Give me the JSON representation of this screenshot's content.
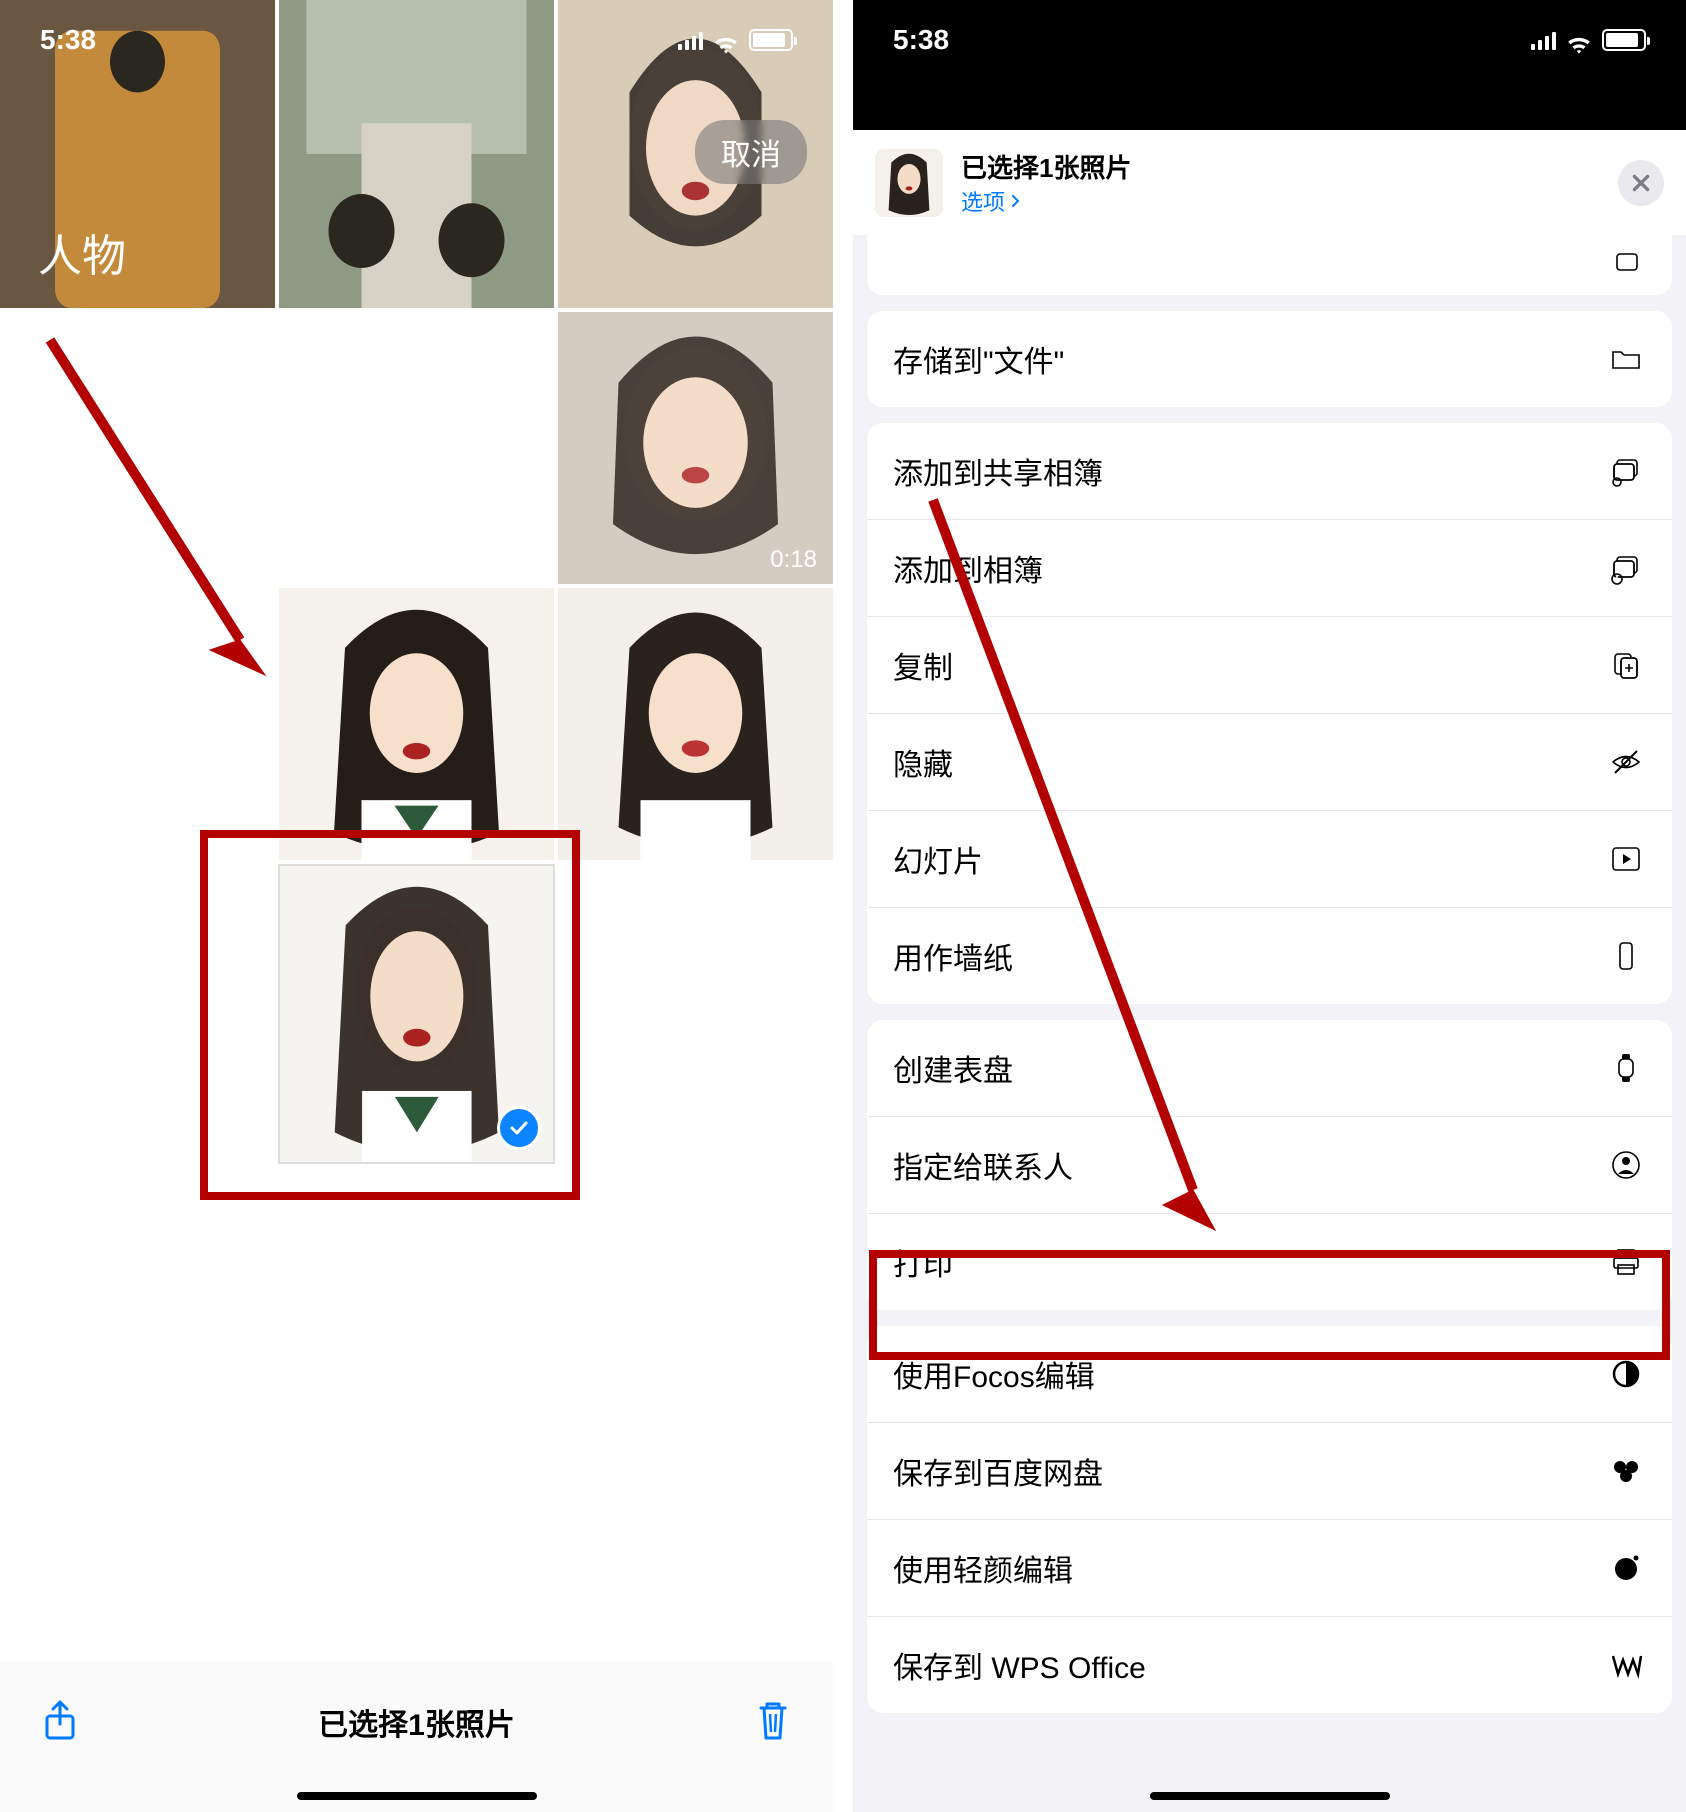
{
  "status": {
    "time": "5:38"
  },
  "left": {
    "album_label": "人物",
    "cancel": "取消",
    "video_duration": "0:18",
    "selected_text": "已选择1张照片"
  },
  "right": {
    "header": {
      "title": "已选择1张照片",
      "options": "选项"
    },
    "groups": [
      {
        "items": [
          {
            "label": "存储到\"文件\"",
            "icon": "folder"
          }
        ]
      },
      {
        "items": [
          {
            "label": "添加到共享相簿",
            "icon": "shared-album"
          },
          {
            "label": "添加到相簿",
            "icon": "add-album"
          },
          {
            "label": "复制",
            "icon": "copy"
          },
          {
            "label": "隐藏",
            "icon": "eye-off"
          },
          {
            "label": "幻灯片",
            "icon": "play"
          },
          {
            "label": "用作墙纸",
            "icon": "wallpaper"
          }
        ]
      },
      {
        "items": [
          {
            "label": "创建表盘",
            "icon": "watch"
          },
          {
            "label": "指定给联系人",
            "icon": "contact"
          },
          {
            "label": "打印",
            "icon": "print"
          }
        ]
      },
      {
        "items": [
          {
            "label": "使用Focos编辑",
            "icon": "focos"
          },
          {
            "label": "保存到百度网盘",
            "icon": "baidu"
          },
          {
            "label": "使用轻颜编辑",
            "icon": "dot"
          },
          {
            "label": "保存到 WPS Office",
            "icon": "wps"
          }
        ]
      }
    ]
  }
}
